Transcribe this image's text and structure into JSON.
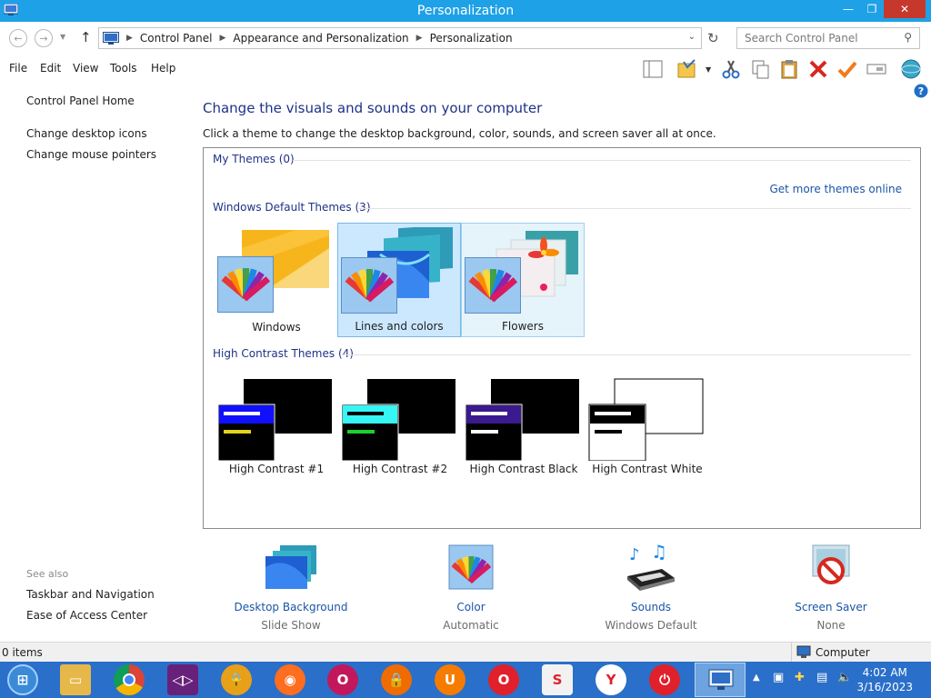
{
  "window": {
    "title": "Personalization",
    "controls": {
      "minimize": "—",
      "maximize": "❐",
      "close": "✕"
    }
  },
  "address": {
    "crumbs": [
      "Control Panel",
      "Appearance and Personalization",
      "Personalization"
    ],
    "search_placeholder": "Search Control Panel"
  },
  "menu": {
    "items": [
      "File",
      "Edit",
      "View",
      "Tools",
      "Help"
    ]
  },
  "left_pane": {
    "links": [
      "Control Panel Home",
      "Change desktop icons",
      "Change mouse pointers"
    ],
    "see_also_label": "See also",
    "see_also_links": [
      "Taskbar and Navigation",
      "Ease of Access Center"
    ]
  },
  "main": {
    "heading": "Change the visuals and sounds on your computer",
    "subtext": "Click a theme to change the desktop background, color, sounds, and screen saver all at once.",
    "my_themes_header": "My Themes (0)",
    "get_more_link": "Get more themes online",
    "default_themes_header": "Windows Default Themes (3)",
    "default_themes": [
      "Windows",
      "Lines and colors",
      "Flowers"
    ],
    "selected_theme": "Lines and colors",
    "hc_themes_header": "High Contrast Themes (4)",
    "hc_themes": [
      "High Contrast #1",
      "High Contrast #2",
      "High Contrast Black",
      "High Contrast White"
    ]
  },
  "options": [
    {
      "title": "Desktop Background",
      "value": "Slide Show"
    },
    {
      "title": "Color",
      "value": "Automatic"
    },
    {
      "title": "Sounds",
      "value": "Windows Default"
    },
    {
      "title": "Screen Saver",
      "value": "None"
    }
  ],
  "status": {
    "items_count": "0 items",
    "location": "Computer"
  },
  "taskbar": {
    "time": "4:02 AM",
    "date": "3/16/2023"
  },
  "colors": {
    "titlebar": "#1ea1e6",
    "link": "#1a55a8",
    "heading": "#1e3287",
    "taskbar": "#2a6fc9",
    "selection": "#cce8ff"
  }
}
